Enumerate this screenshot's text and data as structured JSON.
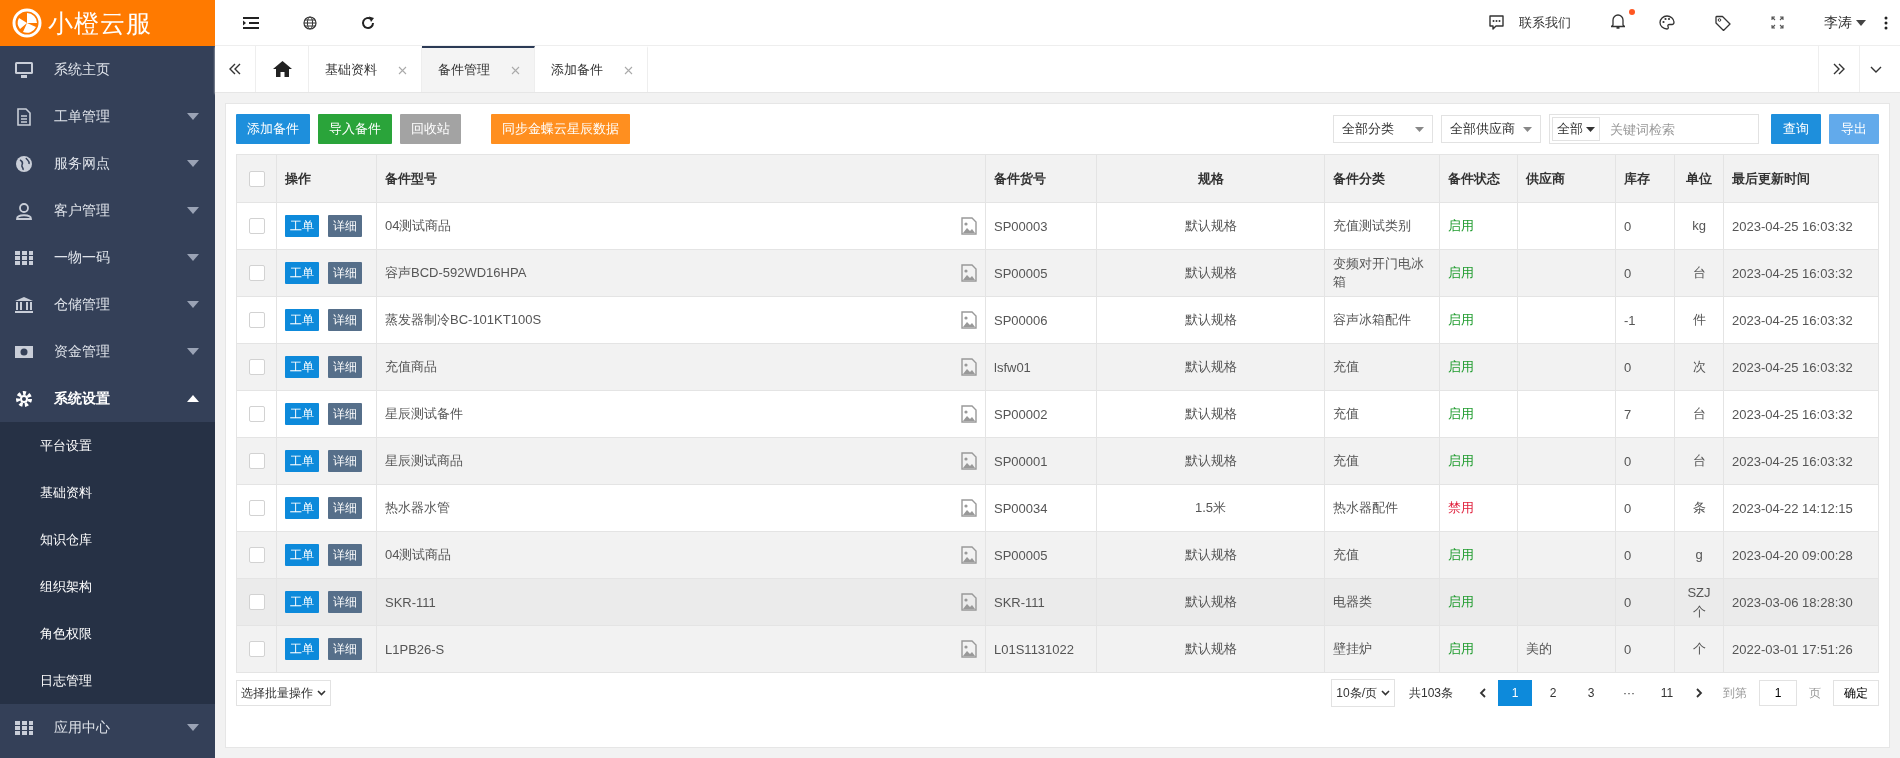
{
  "sidebar": {
    "logo": "小橙云服",
    "items": [
      {
        "label": "系统主页",
        "expandable": false,
        "expanded": false
      },
      {
        "label": "工单管理",
        "expandable": true,
        "expanded": false
      },
      {
        "label": "服务网点",
        "expandable": true,
        "expanded": false
      },
      {
        "label": "客户管理",
        "expandable": true,
        "expanded": false
      },
      {
        "label": "一物一码",
        "expandable": true,
        "expanded": false
      },
      {
        "label": "仓储管理",
        "expandable": true,
        "expanded": false
      },
      {
        "label": "资金管理",
        "expandable": true,
        "expanded": false
      },
      {
        "label": "系统设置",
        "expandable": true,
        "expanded": true,
        "children": [
          {
            "label": "平台设置"
          },
          {
            "label": "基础资料"
          },
          {
            "label": "知识仓库"
          },
          {
            "label": "组织架构"
          },
          {
            "label": "角色权限"
          },
          {
            "label": "日志管理"
          }
        ]
      },
      {
        "label": "应用中心",
        "expandable": true,
        "expanded": false
      }
    ]
  },
  "header": {
    "contact": "联系我们",
    "unread": true,
    "user": "李涛"
  },
  "tabs": [
    {
      "label": "基础资料",
      "selected": false
    },
    {
      "label": "备件管理",
      "selected": true
    },
    {
      "label": "添加备件",
      "selected": false
    }
  ],
  "toolbar": {
    "buttons": [
      {
        "label": "添加备件",
        "kind": "primary"
      },
      {
        "label": "导入备件",
        "kind": "success"
      },
      {
        "label": "回收站",
        "kind": "muted"
      },
      {
        "label": "同步金蝶云星辰数据",
        "kind": "warning"
      }
    ],
    "category": "全部分类",
    "supplier": "全部供应商",
    "scope": "全部",
    "search_placeholder": "关键词检索",
    "query": "查询",
    "export": "导出"
  },
  "table": {
    "all_checked": false,
    "columns": [
      "操作",
      "备件型号",
      "备件货号",
      "规格",
      "备件分类",
      "备件状态",
      "供应商",
      "库存",
      "单位",
      "最后更新时间"
    ],
    "rows": [
      {
        "checked": false,
        "actions": [
          "工单",
          "详细"
        ],
        "model": "04测试商品",
        "code": "SP00003",
        "spec": "默认规格",
        "category": "充值测试类别",
        "status": "启用",
        "enabled": true,
        "supplier": "",
        "stock": "0",
        "unit": "kg",
        "updated": "2023-04-25 16:03:32",
        "highlighted": false
      },
      {
        "checked": false,
        "actions": [
          "工单",
          "详细"
        ],
        "model": "容声BCD-592WD16HPA",
        "code": "SP00005",
        "spec": "默认规格",
        "category": "变频对开门电冰箱",
        "status": "启用",
        "enabled": true,
        "supplier": "",
        "stock": "0",
        "unit": "台",
        "updated": "2023-04-25 16:03:32",
        "highlighted": false
      },
      {
        "checked": false,
        "actions": [
          "工单",
          "详细"
        ],
        "model": "蒸发器制冷BC-101KT100S",
        "code": "SP00006",
        "spec": "默认规格",
        "category": "容声冰箱配件",
        "status": "启用",
        "enabled": true,
        "supplier": "",
        "stock": "-1",
        "unit": "件",
        "updated": "2023-04-25 16:03:32",
        "highlighted": false
      },
      {
        "checked": false,
        "actions": [
          "工单",
          "详细"
        ],
        "model": "充值商品",
        "code": "lsfw01",
        "spec": "默认规格",
        "category": "充值",
        "status": "启用",
        "enabled": true,
        "supplier": "",
        "stock": "0",
        "unit": "次",
        "updated": "2023-04-25 16:03:32",
        "highlighted": false
      },
      {
        "checked": false,
        "actions": [
          "工单",
          "详细"
        ],
        "model": "星辰测试备件",
        "code": "SP00002",
        "spec": "默认规格",
        "category": "充值",
        "status": "启用",
        "enabled": true,
        "supplier": "",
        "stock": "7",
        "unit": "台",
        "updated": "2023-04-25 16:03:32",
        "highlighted": false
      },
      {
        "checked": false,
        "actions": [
          "工单",
          "详细"
        ],
        "model": "星辰测试商品",
        "code": "SP00001",
        "spec": "默认规格",
        "category": "充值",
        "status": "启用",
        "enabled": true,
        "supplier": "",
        "stock": "0",
        "unit": "台",
        "updated": "2023-04-25 16:03:32",
        "highlighted": false
      },
      {
        "checked": false,
        "actions": [
          "工单",
          "详细"
        ],
        "model": "热水器水管",
        "code": "SP00034",
        "spec": "1.5米",
        "category": "热水器配件",
        "status": "禁用",
        "enabled": false,
        "supplier": "",
        "stock": "0",
        "unit": "条",
        "updated": "2023-04-22 14:12:15",
        "highlighted": false
      },
      {
        "checked": false,
        "actions": [
          "工单",
          "详细"
        ],
        "model": "04测试商品",
        "code": "SP00005",
        "spec": "默认规格",
        "category": "充值",
        "status": "启用",
        "enabled": true,
        "supplier": "",
        "stock": "0",
        "unit": "g",
        "updated": "2023-04-20 09:00:28",
        "highlighted": false
      },
      {
        "checked": false,
        "actions": [
          "工单",
          "详细"
        ],
        "model": "SKR-111",
        "code": "SKR-111",
        "spec": "默认规格",
        "category": "电器类",
        "status": "启用",
        "enabled": true,
        "supplier": "",
        "stock": "0",
        "unit": "SZJ个",
        "updated": "2023-03-06 18:28:30",
        "highlighted": true
      },
      {
        "checked": false,
        "actions": [
          "工单",
          "详细"
        ],
        "model": "L1PB26-S",
        "code": "L01S1131022",
        "spec": "默认规格",
        "category": "壁挂炉",
        "status": "启用",
        "enabled": true,
        "supplier": "美的",
        "stock": "0",
        "unit": "个",
        "updated": "2022-03-01 17:51:26",
        "highlighted": false
      }
    ]
  },
  "footer": {
    "batch": "选择批量操作",
    "page_size": "10条/页",
    "total": "共103条",
    "pages": [
      {
        "label": "1",
        "selected": true
      },
      {
        "label": "2",
        "selected": false
      },
      {
        "label": "3",
        "selected": false
      },
      {
        "label": "···",
        "selected": false
      },
      {
        "label": "11",
        "selected": false
      }
    ],
    "goto_label": "到第",
    "goto_value": "1",
    "page_word": "页",
    "confirm": "确定"
  }
}
